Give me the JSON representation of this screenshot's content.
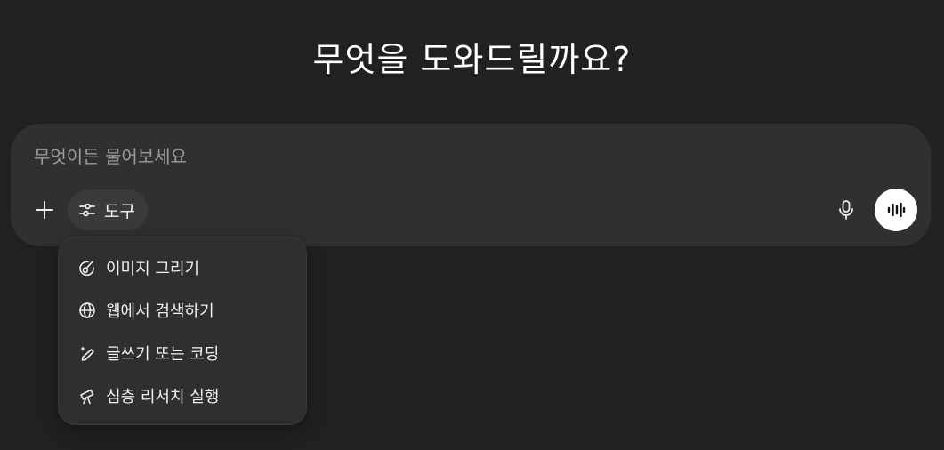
{
  "heading": "무엇을 도와드릴까요?",
  "composer": {
    "placeholder": "무엇이든 물어보세요",
    "add_icon": "plus-icon",
    "tools_label": "도구",
    "tools_icon": "sliders-icon",
    "mic_icon": "microphone-icon",
    "voice_icon": "voice-waveform-icon"
  },
  "tools_menu": {
    "items": [
      {
        "label": "이미지 그리기",
        "icon": "paint-brush-icon"
      },
      {
        "label": "웹에서 검색하기",
        "icon": "globe-icon"
      },
      {
        "label": "글쓰기 또는 코딩",
        "icon": "pen-sparkle-icon"
      },
      {
        "label": "심층 리서치 실행",
        "icon": "telescope-icon"
      }
    ]
  },
  "colors": {
    "background": "#212121",
    "composer": "#303030",
    "menu": "#2f2f2f",
    "text": "#ececec",
    "placeholder": "#9b9b9b",
    "voice_button": "#ffffff"
  }
}
